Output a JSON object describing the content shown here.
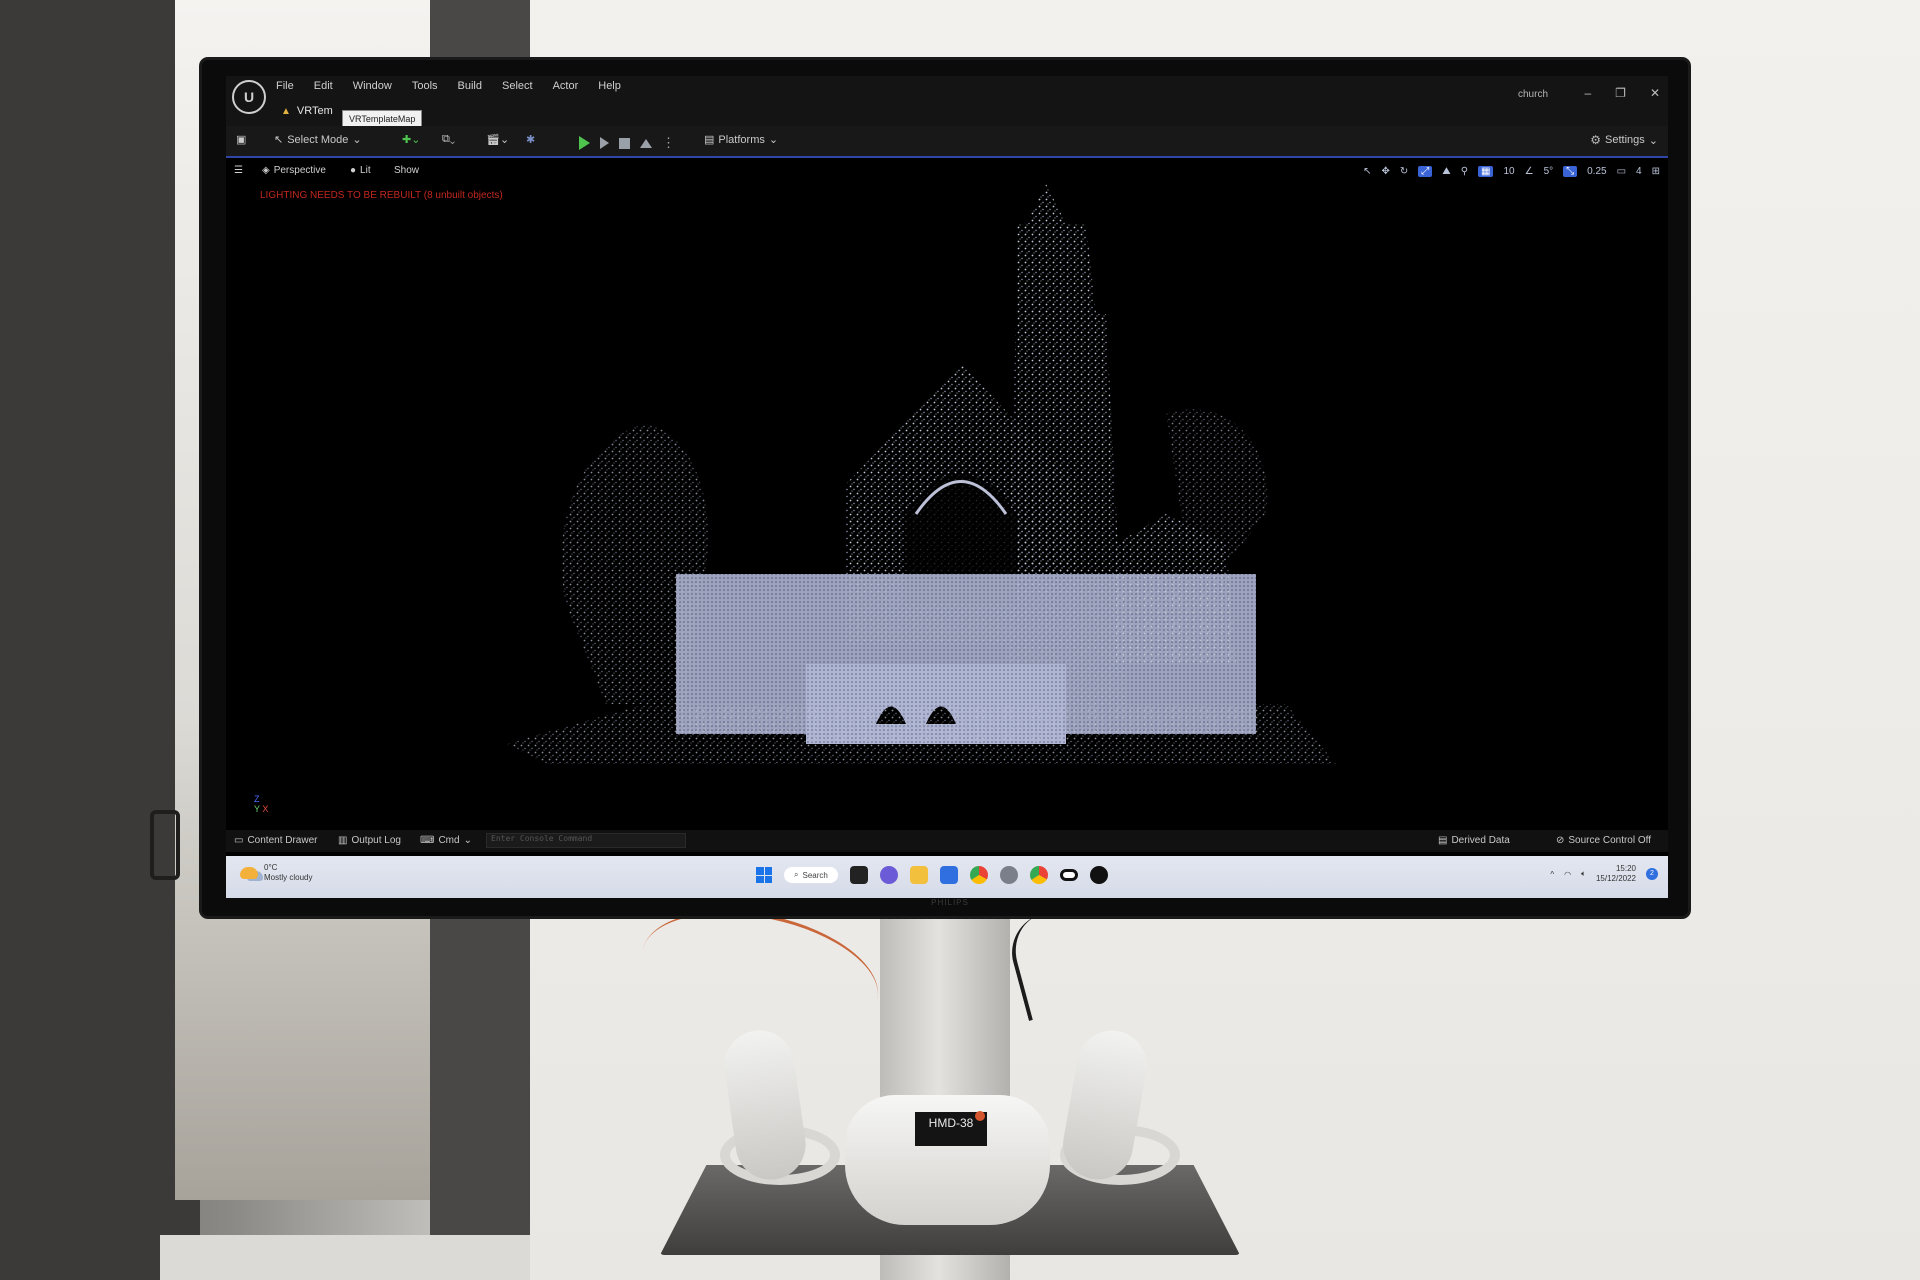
{
  "editor": {
    "menu": [
      "File",
      "Edit",
      "Window",
      "Tools",
      "Build",
      "Select",
      "Actor",
      "Help"
    ],
    "project_name": "church",
    "map_tab": "VRTem",
    "tooltip": "VRTemplateMap",
    "toolbar": {
      "select_mode": "Select Mode",
      "platforms": "Platforms",
      "settings": "Settings"
    },
    "viewport": {
      "perspective": "Perspective",
      "lit": "Lit",
      "show": "Show",
      "grid_snap": "10",
      "rotation_snap": "5°",
      "scale_snap": "0.25",
      "camera_speed": "4",
      "lighting_warning": "LIGHTING NEEDS TO BE REBUILT (8 unbuilt objects)"
    },
    "axis": {
      "z": "Z",
      "y": "Y",
      "x": "X"
    },
    "bottom": {
      "content_drawer": "Content Drawer",
      "output_log": "Output Log",
      "cmd": "Cmd",
      "console_placeholder": "Enter Console Command",
      "derived_data": "Derived Data",
      "source_control": "Source Control Off"
    }
  },
  "taskbar": {
    "weather_temp": "0°C",
    "weather_desc": "Mostly cloudy",
    "search": "Search",
    "time": "15:20",
    "date": "15/12/2022",
    "notifications": "2"
  },
  "monitor": {
    "brand": "PHILIPS"
  },
  "headset": {
    "label": "HMD-38"
  },
  "colors": {
    "accent": "#2f46a7",
    "warning": "#c2281f",
    "play": "#4ec44e"
  }
}
